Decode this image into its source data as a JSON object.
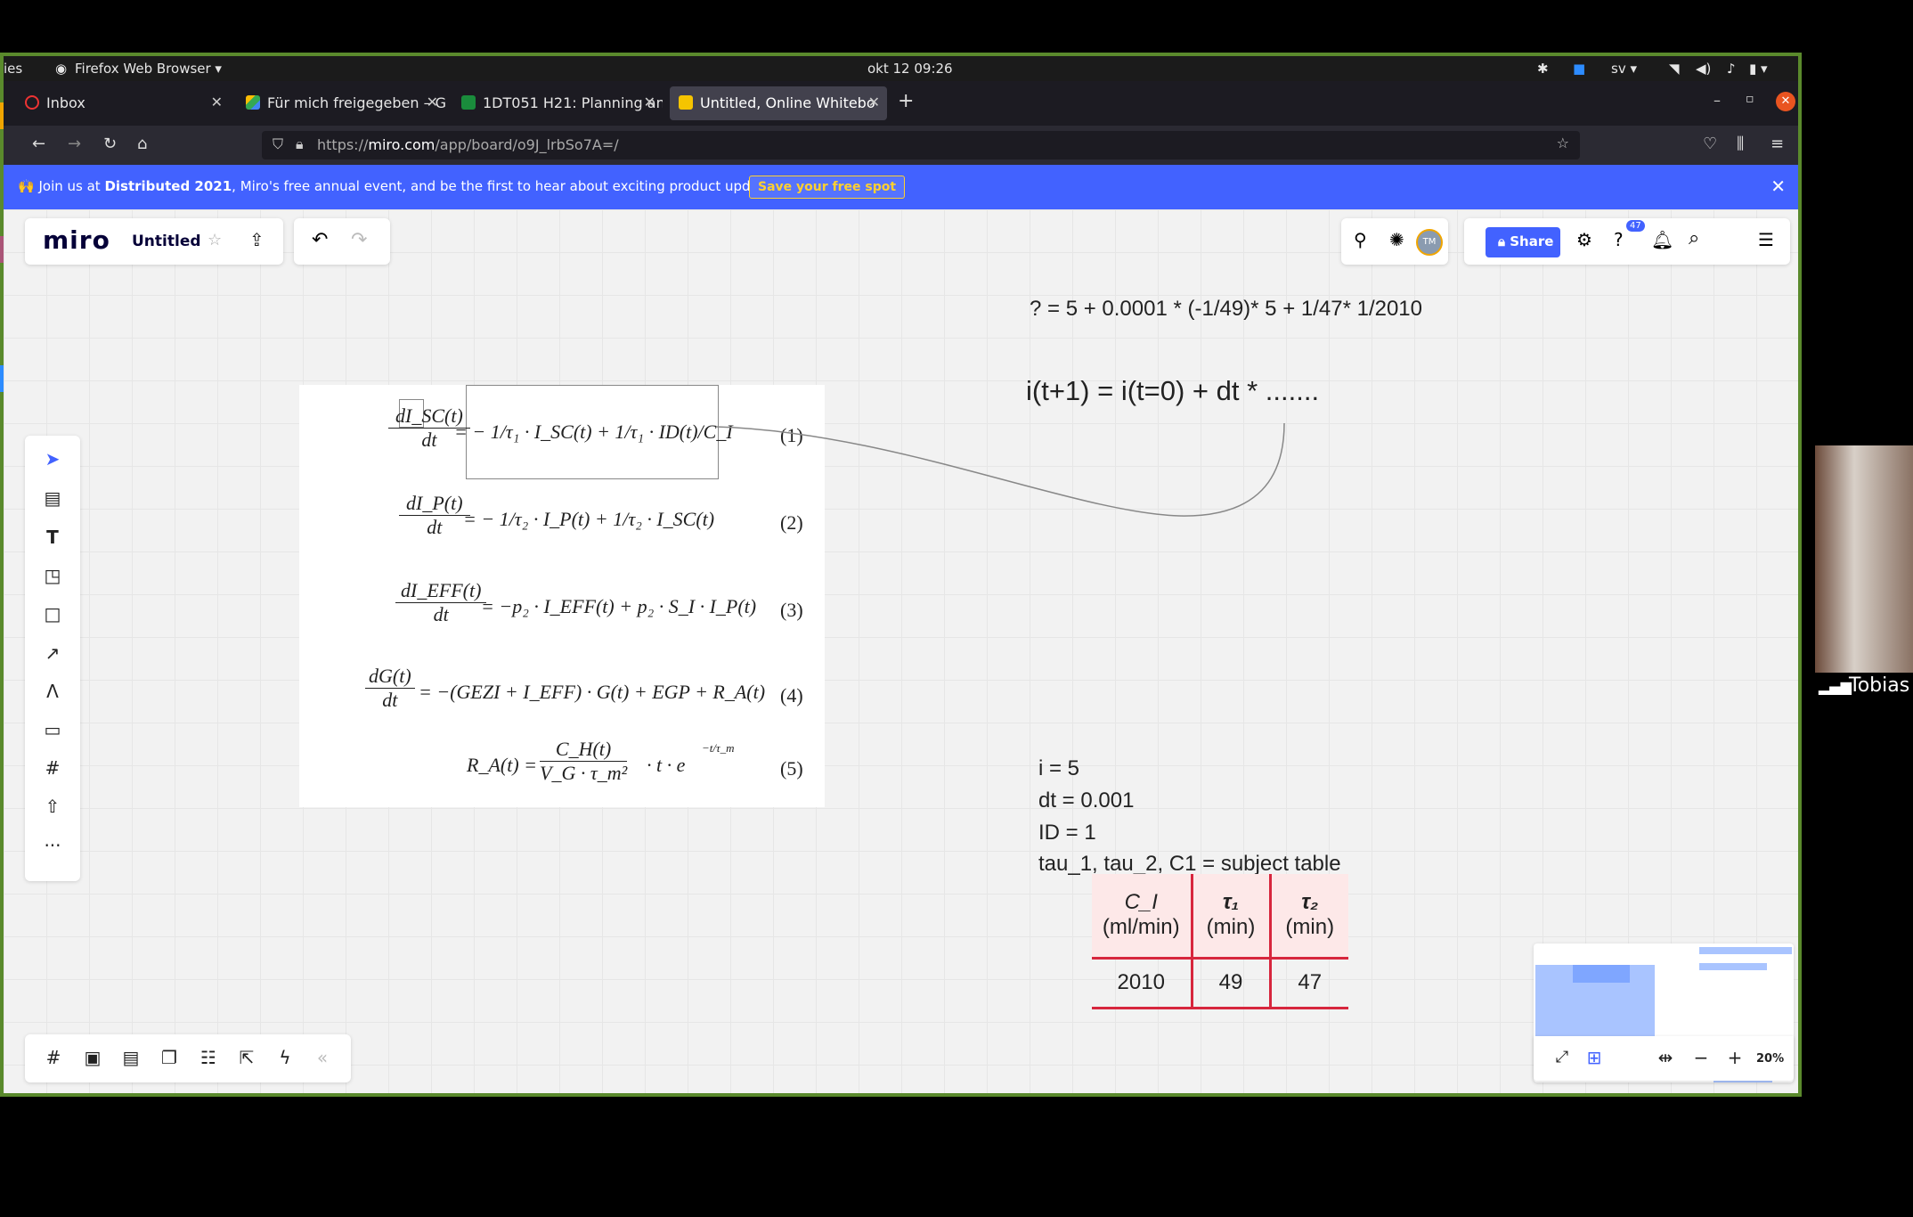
{
  "system_bar": {
    "left_label": "ies",
    "app_menu": "Firefox Web Browser ▾",
    "clock": "okt 12  09:26",
    "lang": "sv ▾"
  },
  "tabs": [
    {
      "label": "Inbox",
      "fav_color": "#e33"
    },
    {
      "label": "Für mich freigegeben – G",
      "fav_color": "#3a7"
    },
    {
      "label": "1DT051 H21: Planning an",
      "fav_color": "#1a8c3c"
    },
    {
      "label": "Untitled, Online Whitebo",
      "fav_color": "#f5c400"
    }
  ],
  "url": {
    "prefix": "https://",
    "domain": "miro.com",
    "path": "/app/board/o9J_lrbSo7A=/"
  },
  "banner": {
    "emoji": "🙌",
    "text_a": "Join us at ",
    "text_bold": "Distributed 2021",
    "text_b": ", Miro's free annual event, and be the first to hear about exciting product updates.",
    "cta": "Save your free spot"
  },
  "board_header": {
    "logo": "miro",
    "title": "Untitled",
    "share": "Share",
    "help_badge": "47",
    "avatar": "TM"
  },
  "equations": {
    "e1": {
      "lhs_num": "dI_SC(t)",
      "lhs_den": "dt",
      "rhs": "= − 1/τ₁ · I_SC(t) + 1/τ₁ · ID(t)/C_I",
      "no": "(1)"
    },
    "e2": {
      "lhs_num": "dI_P(t)",
      "lhs_den": "dt",
      "rhs": "= − 1/τ₂ · I_P(t) + 1/τ₂ · I_SC(t)",
      "no": "(2)"
    },
    "e3": {
      "lhs_num": "dI_EFF(t)",
      "lhs_den": "dt",
      "rhs": "= −p₂ · I_EFF(t) + p₂ · S_I · I_P(t)",
      "no": "(3)"
    },
    "e4": {
      "lhs_num": "dG(t)",
      "lhs_den": "dt",
      "rhs": "= −(GEZI + I_EFF) · G(t) + EGP + R_A(t)",
      "no": "(4)"
    },
    "e5": {
      "lhs": "R_A(t) =",
      "num": "C_H(t)",
      "den": "V_G · τ_m²",
      "tail": "· t · e",
      "exp": "−t/τ_m",
      "no": "(5)"
    }
  },
  "notes": {
    "formula_q": "? = 5 + 0.0001 * (-1/49)* 5 + 1/47* 1/2010",
    "formula_i": "i(t+1) = i(t=0) + dt * .......",
    "line1": "i = 5",
    "line2": "dt = 0.001",
    "line3": "ID = 1",
    "line4": "tau_1, tau_2, C1 = subject table"
  },
  "subject_table": {
    "headers": [
      {
        "sym": "C_I",
        "unit": "(ml/min)"
      },
      {
        "sym": "τ₁",
        "unit": "(min)"
      },
      {
        "sym": "τ₂",
        "unit": "(min)"
      }
    ],
    "row": [
      "2010",
      "49",
      "47"
    ]
  },
  "zoom": "20%",
  "video": {
    "name": "Tobias"
  }
}
